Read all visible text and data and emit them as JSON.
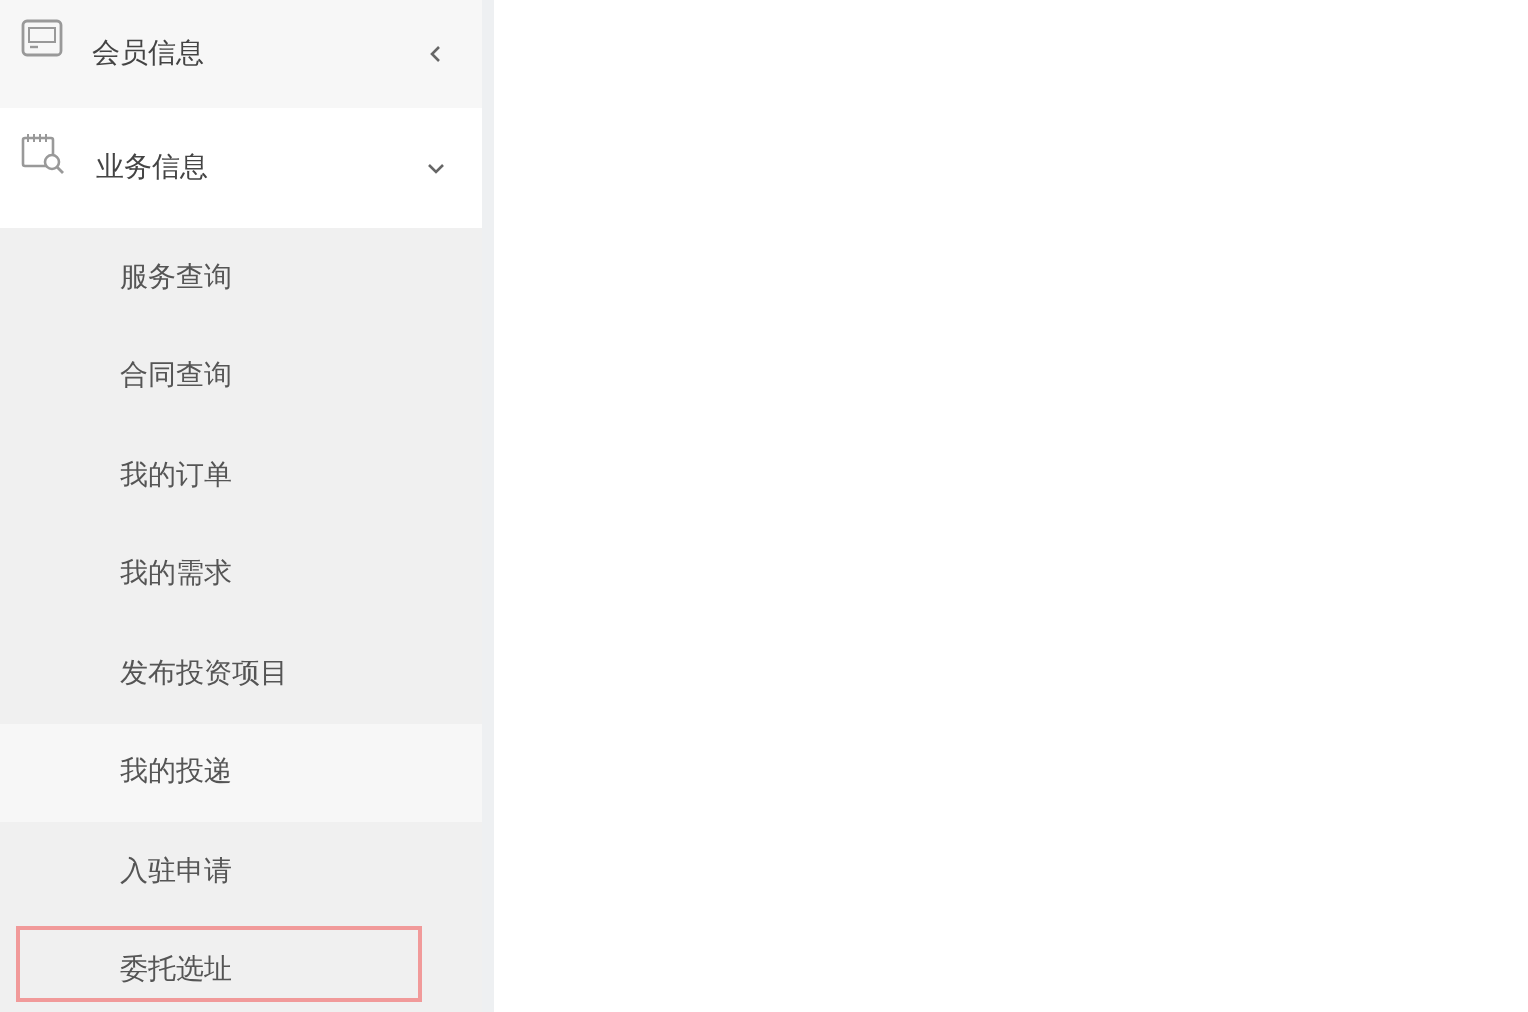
{
  "menu": [
    {
      "label": "会员信息",
      "kind": "card",
      "expanded": false
    },
    {
      "label": "业务信息",
      "kind": "calendar",
      "expanded": true,
      "children": [
        {
          "label": "服务查询",
          "selected": false,
          "outlined": false
        },
        {
          "label": "合同查询",
          "selected": false,
          "outlined": false
        },
        {
          "label": "我的订单",
          "selected": false,
          "outlined": false
        },
        {
          "label": "我的需求",
          "selected": false,
          "outlined": false
        },
        {
          "label": "发布投资项目",
          "selected": false,
          "outlined": false
        },
        {
          "label": "我的投递",
          "selected": true,
          "outlined": false
        },
        {
          "label": "入驻申请",
          "selected": false,
          "outlined": false
        },
        {
          "label": "委托选址",
          "selected": false,
          "outlined": true
        }
      ]
    }
  ]
}
